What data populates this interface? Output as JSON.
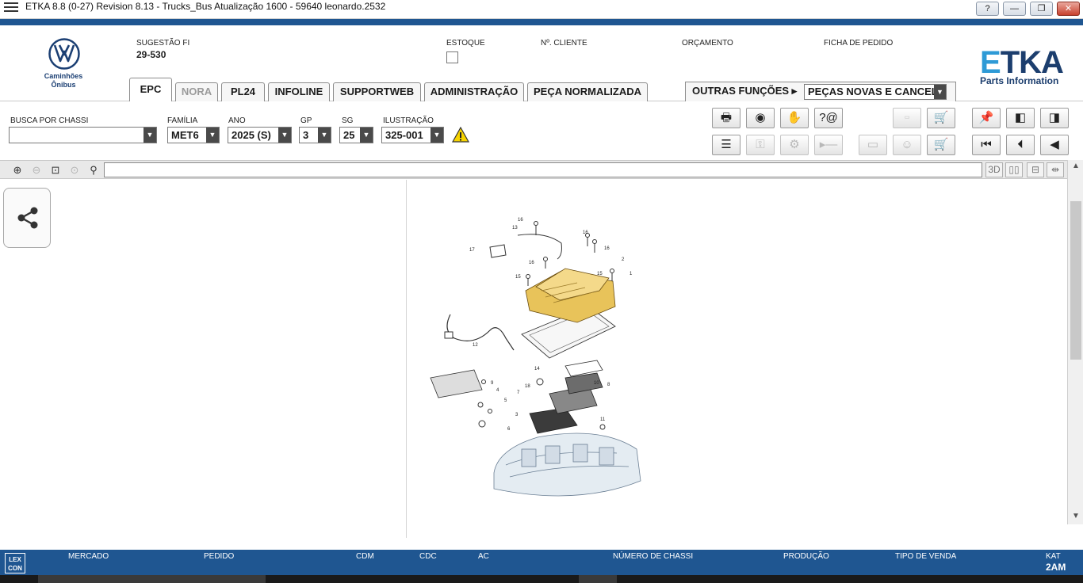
{
  "window": {
    "title": "ETKA 8.8 (0-27) Revision 8.13 - Trucks_Bus Atualização 1600 - 59640 leonardo.2532",
    "help": "?",
    "minimize": "—",
    "restore": "❐",
    "close": "✕"
  },
  "brand": {
    "line1": "Caminhões",
    "line2": "Ônibus",
    "etka_e": "E",
    "etka_rest": "TKA",
    "etka_sub": "Parts Information"
  },
  "header": {
    "sugestao_label": "SUGESTÃO FI",
    "sugestao_value": "29-530",
    "estoque_label": "ESTOQUE",
    "cliente_label": "Nº. CLIENTE",
    "orcamento_label": "ORÇAMENTO",
    "ficha_label": "FICHA DE PEDIDO"
  },
  "tabs": [
    {
      "label": "EPC",
      "state": "active"
    },
    {
      "label": "NORA",
      "state": "disabled"
    },
    {
      "label": "PL24",
      "state": "normal"
    },
    {
      "label": "INFOLINE",
      "state": "normal"
    },
    {
      "label": "SUPPORTWEB",
      "state": "normal"
    },
    {
      "label": "ADMINISTRAÇÃO",
      "state": "normal"
    },
    {
      "label": "PEÇA NORMALIZADA",
      "state": "normal"
    }
  ],
  "other_functions": {
    "label": "OUTRAS FUNÇÕES ▸",
    "selected": "PEÇAS NOVAS E CANCEL."
  },
  "filters": {
    "chassi_label": "BUSCA POR CHASSI",
    "chassi_value": "",
    "familia_label": "FAMÍLIA",
    "familia_value": "MET6",
    "ano_label": "ANO",
    "ano_value": "2025 (S)",
    "gp_label": "GP",
    "gp_value": "3",
    "sg_label": "SG",
    "sg_value": "25",
    "ilustracao_label": "ILUSTRAÇÃO",
    "ilustracao_value": "325-001"
  },
  "status": {
    "mercado": "MERCADO",
    "pedido": "PEDIDO",
    "cdm": "CDM",
    "cdc": "CDC",
    "ac": "AC",
    "chassi": "NÚMERO DE CHASSI",
    "producao": "PRODUÇÃO",
    "tipo_venda": "TIPO DE VENDA",
    "kat_label": "KAT",
    "kat_value": "2AM",
    "lexcon_1": "LEX",
    "lexcon_2": "CON"
  },
  "zoom_right": {
    "btn_3d": "3D"
  },
  "diagram_callouts": [
    "16",
    "13",
    "17",
    "16",
    "16",
    "16",
    "2",
    "1",
    "15",
    "15",
    "12",
    "14",
    "10",
    "8",
    "9",
    "18",
    "7",
    "5",
    "4",
    "3",
    "6",
    "11"
  ],
  "colors": {
    "accent_blue": "#1f5691",
    "etka_blue": "#2e9ad6",
    "part_highlight": "#e8c35a"
  }
}
